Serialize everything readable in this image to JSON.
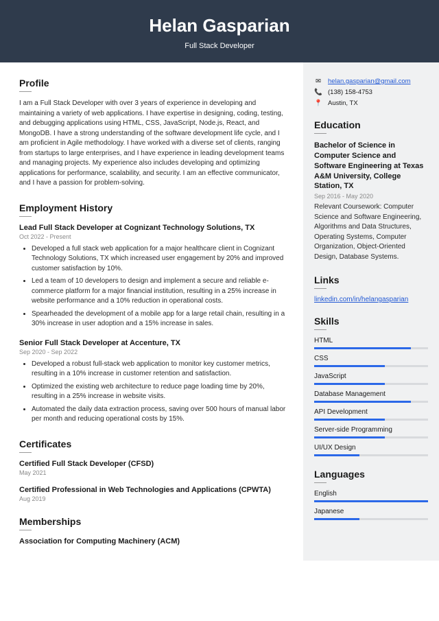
{
  "header": {
    "name": "Helan Gasparian",
    "title": "Full Stack Developer"
  },
  "profile": {
    "heading": "Profile",
    "text": "I am a Full Stack Developer with over 3 years of experience in developing and maintaining a variety of web applications. I have expertise in designing, coding, testing, and debugging applications using HTML, CSS, JavaScript, Node.js, React, and MongoDB. I have a strong understanding of the software development life cycle, and I am proficient in Agile methodology. I have worked with a diverse set of clients, ranging from startups to large enterprises, and I have experience in leading development teams and managing projects. My experience also includes developing and optimizing applications for performance, scalability, and security. I am an effective communicator, and I have a passion for problem-solving."
  },
  "employment": {
    "heading": "Employment History",
    "jobs": [
      {
        "title": "Lead Full Stack Developer at Cognizant Technology Solutions, TX",
        "date": "Oct 2022 - Present",
        "bullets": [
          "Developed a full stack web application for a major healthcare client in Cognizant Technology Solutions, TX which increased user engagement by 20% and improved customer satisfaction by 10%.",
          "Led a team of 10 developers to design and implement a secure and reliable e-commerce platform for a major financial institution, resulting in a 25% increase in website performance and a 10% reduction in operational costs.",
          "Spearheaded the development of a mobile app for a large retail chain, resulting in a 30% increase in user adoption and a 15% increase in sales."
        ]
      },
      {
        "title": "Senior Full Stack Developer at Accenture, TX",
        "date": "Sep 2020 - Sep 2022",
        "bullets": [
          "Developed a robust full-stack web application to monitor key customer metrics, resulting in a 10% increase in customer retention and satisfaction.",
          "Optimized the existing web architecture to reduce page loading time by 20%, resulting in a 25% increase in website visits.",
          "Automated the daily data extraction process, saving over 500 hours of manual labor per month and reducing operational costs by 15%."
        ]
      }
    ]
  },
  "certs": {
    "heading": "Certificates",
    "items": [
      {
        "title": "Certified Full Stack Developer (CFSD)",
        "date": "May 2021"
      },
      {
        "title": "Certified Professional in Web Technologies and Applications (CPWTA)",
        "date": "Aug 2019"
      }
    ]
  },
  "memberships": {
    "heading": "Memberships",
    "items": [
      {
        "title": "Association for Computing Machinery (ACM)"
      }
    ]
  },
  "contact": {
    "email": "helan.gasparian@gmail.com",
    "phone": "(138) 158-4753",
    "location": "Austin, TX"
  },
  "education": {
    "heading": "Education",
    "title": "Bachelor of Science in Computer Science and Software Engineering at Texas A&M University, College Station, TX",
    "date": "Sep 2016 - May 2020",
    "desc": "Relevant Coursework: Computer Science and Software Engineering, Algorithms and Data Structures, Operating Systems, Computer Organization, Object-Oriented Design, Database Systems."
  },
  "links": {
    "heading": "Links",
    "items": [
      "linkedin.com/in/helangasparian"
    ]
  },
  "skills": {
    "heading": "Skills",
    "items": [
      {
        "name": "HTML",
        "level": 85
      },
      {
        "name": "CSS",
        "level": 62
      },
      {
        "name": "JavaScript",
        "level": 62
      },
      {
        "name": "Database Management",
        "level": 85
      },
      {
        "name": "API Development",
        "level": 62
      },
      {
        "name": "Server-side Programming",
        "level": 62
      },
      {
        "name": "UI/UX Design",
        "level": 40
      }
    ]
  },
  "languages": {
    "heading": "Languages",
    "items": [
      {
        "name": "English",
        "level": 100
      },
      {
        "name": "Japanese",
        "level": 40
      }
    ]
  }
}
